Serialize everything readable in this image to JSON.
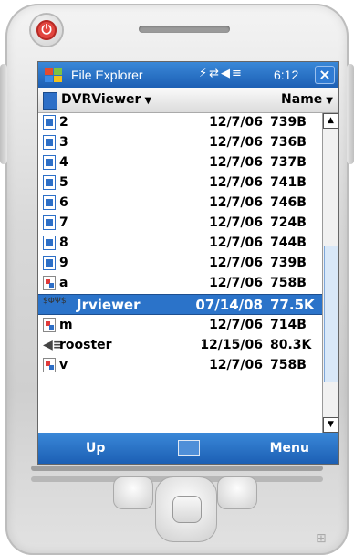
{
  "titlebar": {
    "app_title": "File Explorer",
    "time": "6:12",
    "close_label": "×",
    "status_icons": "⚡⇄◀≡"
  },
  "header": {
    "folder": "DVRViewer",
    "sort_label": "Name"
  },
  "files": [
    {
      "name": "2",
      "date": "12/7/06",
      "size": "739B",
      "type": "doc"
    },
    {
      "name": "3",
      "date": "12/7/06",
      "size": "736B",
      "type": "doc"
    },
    {
      "name": "4",
      "date": "12/7/06",
      "size": "737B",
      "type": "doc"
    },
    {
      "name": "5",
      "date": "12/7/06",
      "size": "741B",
      "type": "doc"
    },
    {
      "name": "6",
      "date": "12/7/06",
      "size": "746B",
      "type": "doc"
    },
    {
      "name": "7",
      "date": "12/7/06",
      "size": "724B",
      "type": "doc"
    },
    {
      "name": "8",
      "date": "12/7/06",
      "size": "744B",
      "type": "doc"
    },
    {
      "name": "9",
      "date": "12/7/06",
      "size": "739B",
      "type": "doc"
    },
    {
      "name": "a",
      "date": "12/7/06",
      "size": "758B",
      "type": "image"
    },
    {
      "name": "Jrviewer",
      "date": "07/14/08",
      "size": "77.5K",
      "type": "exe",
      "selected": true
    },
    {
      "name": "m",
      "date": "12/7/06",
      "size": "714B",
      "type": "image"
    },
    {
      "name": "rooster",
      "date": "12/15/06",
      "size": "80.3K",
      "type": "sound"
    },
    {
      "name": "v",
      "date": "12/7/06",
      "size": "758B",
      "type": "image"
    }
  ],
  "softkeys": {
    "left": "Up",
    "right": "Menu"
  },
  "colors": {
    "accent_blue": "#2b73c9",
    "power_red": "#e2463f"
  }
}
